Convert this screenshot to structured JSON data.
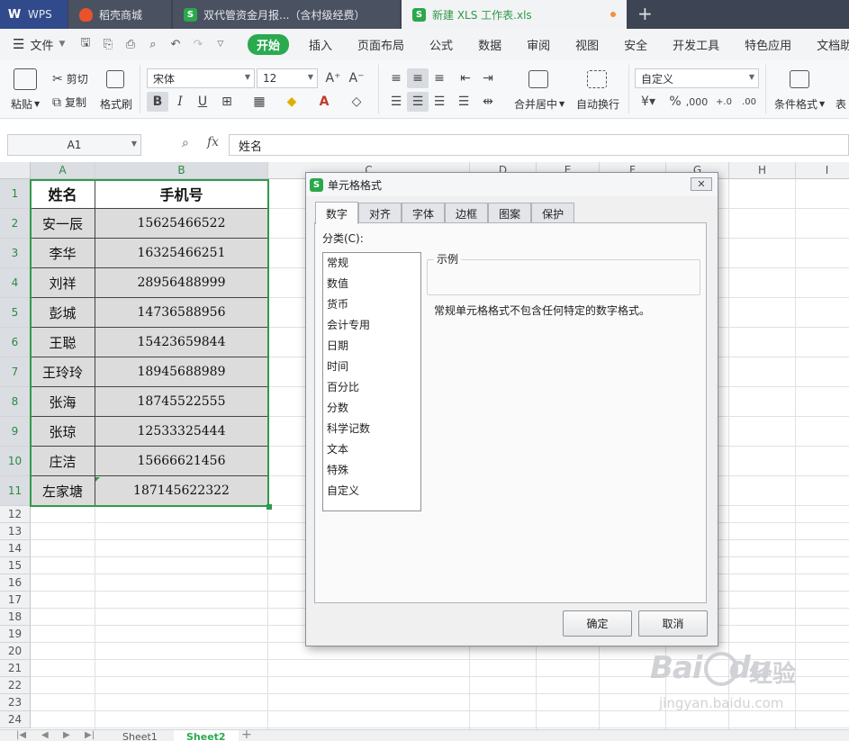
{
  "app_tabs": [
    {
      "label": "WPS"
    },
    {
      "label": "稻壳商城"
    },
    {
      "label": "双代管资金月报...（含村级经费）"
    },
    {
      "label": "新建 XLS 工作表.xls"
    }
  ],
  "menu": {
    "file_label": "文件",
    "items": [
      "开始",
      "插入",
      "页面布局",
      "公式",
      "数据",
      "审阅",
      "视图",
      "安全",
      "开发工具",
      "特色应用",
      "文档助手"
    ]
  },
  "ribbon": {
    "paste": "粘贴",
    "cut": "剪切",
    "copy": "复制",
    "format_painter": "格式刷",
    "font_name": "宋体",
    "font_size": "12",
    "bold": "B",
    "italic": "I",
    "underline": "U",
    "merge_center": "合并居中",
    "wrap_text": "自动换行",
    "number_format": "自定义",
    "conditional_format": "条件格式",
    "table_style": "表"
  },
  "formula_bar": {
    "name_box": "A1",
    "fx": "fx",
    "content": "姓名"
  },
  "sheet": {
    "columns": [
      "A",
      "B",
      "C",
      "D",
      "E",
      "F",
      "G",
      "H",
      "I"
    ],
    "rows": [
      "1",
      "2",
      "3",
      "4",
      "5",
      "6",
      "7",
      "8",
      "9",
      "10",
      "11",
      "12",
      "13",
      "14",
      "15",
      "16",
      "17",
      "18",
      "19",
      "20",
      "21",
      "22",
      "23",
      "24"
    ],
    "header": {
      "name": "姓名",
      "phone": "手机号"
    },
    "records": [
      {
        "name": "安一辰",
        "phone": "15625466522"
      },
      {
        "name": "李华",
        "phone": "16325466251"
      },
      {
        "name": "刘祥",
        "phone": "28956488999"
      },
      {
        "name": "彭城",
        "phone": "14736588956"
      },
      {
        "name": "王聪",
        "phone": "15423659844"
      },
      {
        "name": "王玲玲",
        "phone": "18945688989"
      },
      {
        "name": "张海",
        "phone": "18745522555"
      },
      {
        "name": "张琼",
        "phone": "12533325444"
      },
      {
        "name": "庄洁",
        "phone": "15666621456"
      },
      {
        "name": "左家塘",
        "phone": "187145622322"
      }
    ],
    "sheet_tabs": [
      "Sheet1",
      "Sheet2"
    ],
    "add_sheet": "+"
  },
  "dialog": {
    "title": "单元格格式",
    "close": "✕",
    "tabs": [
      "数字",
      "对齐",
      "字体",
      "边框",
      "图案",
      "保护"
    ],
    "category_label": "分类(C):",
    "categories": [
      "常规",
      "数值",
      "货币",
      "会计专用",
      "日期",
      "时间",
      "百分比",
      "分数",
      "科学记数",
      "文本",
      "特殊",
      "自定义"
    ],
    "sample_label": "示例",
    "description": "常规单元格格式不包含任何特定的数字格式。",
    "ok": "确定",
    "cancel": "取消"
  },
  "watermark": {
    "brand": "Bai",
    "brand2": "du",
    "cn": "经验",
    "url": "jingyan.baidu.com"
  },
  "colors": {
    "accent_green": "#2aaa4f",
    "tab_bar": "#3d4453",
    "selection_border": "#2e9a4a"
  }
}
